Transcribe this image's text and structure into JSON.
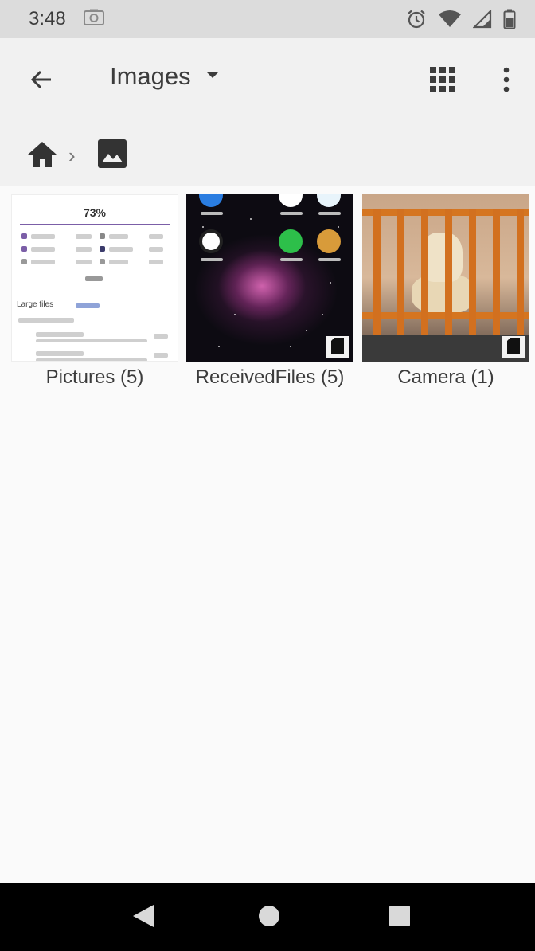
{
  "status_bar": {
    "time": "3:48",
    "icons": [
      "screenshot-icon",
      "alarm-icon",
      "wifi-icon",
      "signal-icon",
      "battery-icon"
    ]
  },
  "app_bar": {
    "title": "Images",
    "back_icon": "arrow-back-icon",
    "dropdown_icon": "arrow-drop-down-icon",
    "grid_icon": "grid-view-icon",
    "more_icon": "more-vert-icon"
  },
  "breadcrumb": {
    "home_icon": "home-icon",
    "separator": "›",
    "current_icon": "image-icon"
  },
  "folders": [
    {
      "label": "Pictures (5)",
      "thumbnail": "storage-screenshot",
      "pct": "73%",
      "large_files": "Large files"
    },
    {
      "label": "ReceivedFiles (5)",
      "thumbnail": "nebula-home-screen",
      "sd_card": true
    },
    {
      "label": "Camera (1)",
      "thumbnail": "dog-behind-gate",
      "sd_card": true
    }
  ],
  "colors": {
    "status_bar_bg": "#dcdcdc",
    "app_bar_bg": "#f1f1f1",
    "content_bg": "#fafafa",
    "nav_bar_bg": "#000000",
    "nav_icon": "#d9d9d9"
  },
  "nav_bar": {
    "back_icon": "nav-back-icon",
    "home_icon": "nav-home-icon",
    "recents_icon": "nav-recents-icon"
  }
}
